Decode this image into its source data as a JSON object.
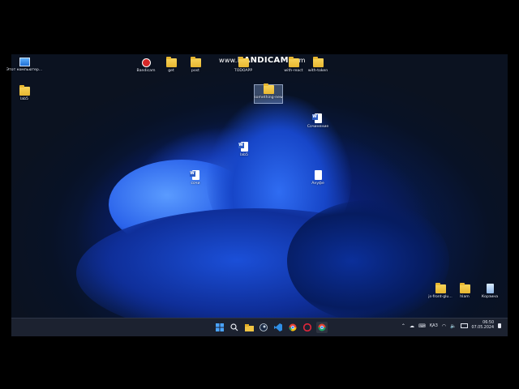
{
  "watermark": {
    "prefix": "www.",
    "brand": "BANDICAM",
    "suffix": ".com"
  },
  "desktop_icons": {
    "this_pc": "Этот компьютер...",
    "lab5": "lab5",
    "bandicam": "Bandicam",
    "get": "get",
    "post": "post",
    "todoapp": "TODOAPP",
    "with_react": "with-react",
    "with_token": "with-token",
    "selected_folder": "something-new",
    "word_doc_top": "Сочинение",
    "word_doc_mid": "lab5",
    "word_doc_left": "сочи",
    "plain_doc": "Aнуфe",
    "js_front": "js-front-glu...",
    "hlam": "hlam",
    "recycle_bin": "Корзина"
  },
  "taskbar": {
    "apps": [
      "start-icon",
      "search-icon",
      "file-explorer-icon",
      "steam-icon",
      "vscode-icon",
      "chrome-icon",
      "opera-icon",
      "chrome-alt-icon"
    ]
  },
  "tray": {
    "lang": "ҚАЗ",
    "time": "06:50",
    "date": "07.05.2024"
  },
  "colors": {
    "taskbar": "#1c2230",
    "accent": "#1f5fe0",
    "folder": "#f0c443"
  }
}
